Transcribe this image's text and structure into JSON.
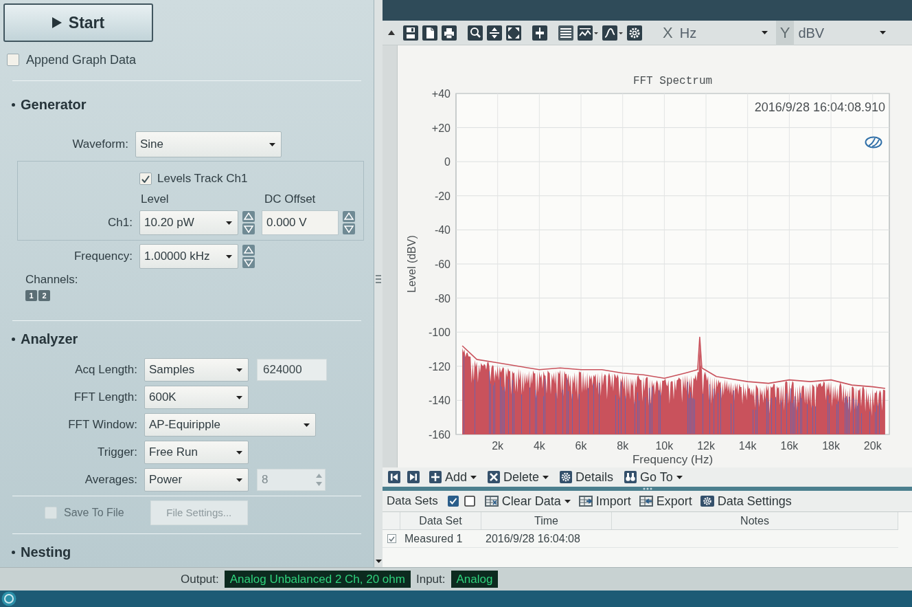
{
  "run": {
    "start_button": "Start",
    "append_graph_data": {
      "label": "Append Graph Data",
      "checked": false
    }
  },
  "generator": {
    "title": "Generator",
    "waveform": {
      "label": "Waveform:",
      "value": "Sine"
    },
    "levels_track": {
      "label": "Levels Track Ch1",
      "checked": true
    },
    "level_header": "Level",
    "dc_offset_header": "DC Offset",
    "ch1": {
      "label": "Ch1:",
      "level": "10.20 pW",
      "dc_offset": "0.000 V"
    },
    "frequency": {
      "label": "Frequency:",
      "value": "1.00000 kHz"
    },
    "channels": {
      "label": "Channels:",
      "buttons": [
        {
          "label": "1",
          "on": true
        },
        {
          "label": "2",
          "on": true
        }
      ]
    }
  },
  "analyzer": {
    "title": "Analyzer",
    "rows": [
      {
        "kind": "select-with-field",
        "label": "Acq Length:",
        "value": "Samples",
        "field": "624000"
      },
      {
        "kind": "select",
        "label": "FFT Length:",
        "value": "600K"
      },
      {
        "kind": "wide-select",
        "label": "FFT Window:",
        "value": "AP-Equiripple"
      },
      {
        "kind": "select",
        "label": "Trigger:",
        "value": "Free Run"
      },
      {
        "kind": "select-with-spinner",
        "label": "Averages:",
        "value": "Power",
        "field": "8"
      }
    ],
    "save_to_file": {
      "label": "Save To File",
      "checked": false,
      "disabled": true
    },
    "file_settings": {
      "label": "File Settings...",
      "disabled": true
    }
  },
  "nesting": {
    "title": "Nesting"
  },
  "graph": {
    "toolbar": {
      "x_axis": {
        "label": "X",
        "unit": "Hz"
      },
      "y_axis": {
        "label": "Y",
        "unit": "dBV"
      }
    },
    "timestamp": "2016/9/28 16:04:08.910",
    "chart_data": {
      "type": "line",
      "title": "FFT Spectrum",
      "xlabel": "Frequency (Hz)",
      "ylabel": "Level (dBV)",
      "grid": true,
      "x": [
        300,
        1000,
        2000,
        3000,
        4000,
        5000,
        6000,
        7000,
        8000,
        9000,
        10000,
        11000,
        11600,
        11700,
        11800,
        12500,
        13000,
        14000,
        15000,
        16000,
        17000,
        18000,
        19000,
        20000,
        20600
      ],
      "series": [
        {
          "color": "#c9525c",
          "values": [
            -108,
            -116,
            -118,
            -120,
            -122,
            -121,
            -122,
            -122,
            -124,
            -125,
            -127,
            -124,
            -122,
            -103,
            -121,
            -126,
            -127,
            -129,
            -130,
            -128,
            -129,
            -128,
            -131,
            -132,
            -133
          ]
        }
      ],
      "xlim": [
        0,
        20800
      ],
      "ylim": [
        -160,
        40
      ],
      "xticks": [
        {
          "value": 2000,
          "label": "2k"
        },
        {
          "value": 4000,
          "label": "4k"
        },
        {
          "value": 6000,
          "label": "6k"
        },
        {
          "value": 8000,
          "label": "8k"
        },
        {
          "value": 10000,
          "label": "10k"
        },
        {
          "value": 12000,
          "label": "12k"
        },
        {
          "value": 14000,
          "label": "14k"
        },
        {
          "value": 16000,
          "label": "16k"
        },
        {
          "value": 18000,
          "label": "18k"
        },
        {
          "value": 20000,
          "label": "20k"
        }
      ],
      "yticks": [
        {
          "value": 40,
          "label": "+40"
        },
        {
          "value": 20,
          "label": "+20"
        },
        0,
        -20,
        -40,
        -60,
        -80,
        -100,
        -120,
        -140,
        -160
      ]
    }
  },
  "graph_nav": [
    {
      "kind": "add",
      "label": "Add",
      "dropdown": true
    },
    {
      "kind": "delete",
      "label": "Delete",
      "dropdown": true
    },
    {
      "kind": "details",
      "label": "Details",
      "dropdown": false
    },
    {
      "kind": "goto",
      "label": "Go To",
      "dropdown": true
    }
  ],
  "data_sets": {
    "title": "Data Sets",
    "toolbar": [
      {
        "kind": "clear",
        "label": "Clear Data",
        "dropdown": true
      },
      {
        "kind": "import",
        "label": "Import",
        "dropdown": false
      },
      {
        "kind": "export",
        "label": "Export",
        "dropdown": false
      },
      {
        "kind": "settings",
        "label": "Data Settings",
        "dropdown": false
      }
    ],
    "columns": [
      "Data Set",
      "Time",
      "Notes"
    ],
    "rows": [
      {
        "checked": true,
        "data_set": "Measured 1",
        "time": "2016/9/28 16:04:08"
      }
    ]
  },
  "status_bar": {
    "output_label": "Output:",
    "output": "Analog Unbalanced 2 Ch, 20 ohm",
    "input_label": "Input:",
    "input": "Analog"
  }
}
